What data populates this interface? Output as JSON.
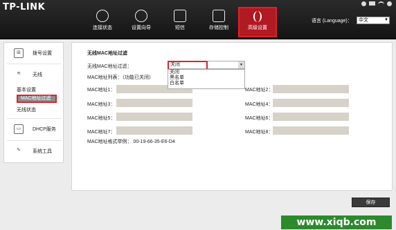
{
  "header": {
    "logo": "TP-LINK",
    "nav": [
      {
        "label": "连接状态",
        "icon": "globe-icon"
      },
      {
        "label": "设置向导",
        "icon": "wizard-icon"
      },
      {
        "label": "短信",
        "icon": "message-icon"
      },
      {
        "label": "存储控制",
        "icon": "storage-icon"
      },
      {
        "label": "高级设置",
        "icon": "tools-icon"
      }
    ],
    "language_label": "语言 (Language)：",
    "language_value": "中文"
  },
  "sidebar": {
    "items": [
      {
        "label": "拨号设置",
        "icon": "dialup-icon"
      },
      {
        "label": "无线",
        "icon": "wifi-icon"
      },
      {
        "label": "DHCP服务",
        "icon": "dhcp-icon"
      },
      {
        "label": "系统工具",
        "icon": "wrench-icon"
      }
    ],
    "wireless_sub": [
      "基本设置",
      "MAC地址过滤",
      "无线状态"
    ]
  },
  "main": {
    "title": "无线MAC地址过滤",
    "filter_label": "无线MAC地址过滤：",
    "filter_value": "关闭",
    "filter_options": [
      "关闭",
      "黑名单",
      "白名单"
    ],
    "list_label": "MAC地址列表：（功能已关闭）",
    "mac_labels": [
      "MAC地址1：",
      "MAC地址2：",
      "MAC地址3：",
      "MAC地址4：",
      "MAC地址5：",
      "MAC地址6：",
      "MAC地址7：",
      "MAC地址8："
    ],
    "example": "MAC地址格式举例：  00-19-66-35-E6-D4"
  },
  "footer": {
    "save_label": "保存",
    "watermark": "www.xiqb.com"
  }
}
